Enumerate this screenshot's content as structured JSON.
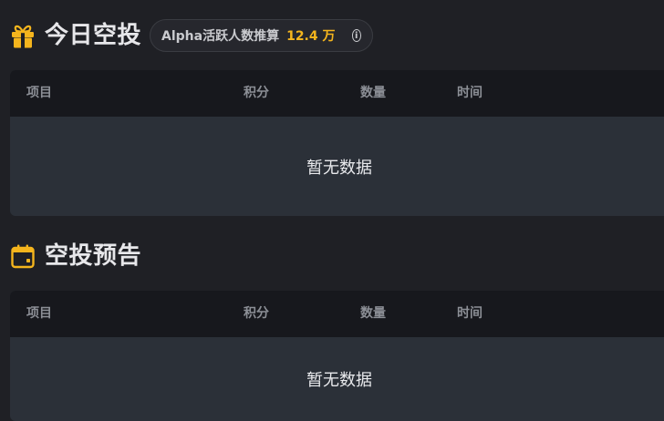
{
  "airdrop_today": {
    "title": "今日空投",
    "pill": {
      "label": "Alpha活跃人数推算",
      "value": "12.4 万",
      "info_symbol": "i"
    },
    "table": {
      "columns": [
        "项目",
        "积分",
        "数量",
        "时间"
      ],
      "empty_text": "暂无数据"
    }
  },
  "airdrop_forecast": {
    "title": "空投预告",
    "table": {
      "columns": [
        "项目",
        "积分",
        "数量",
        "时间"
      ],
      "empty_text": "暂无数据"
    }
  },
  "colors": {
    "background": "#1f2025",
    "table_header": "#17181d",
    "table_body": "#2b3038",
    "accent": "#f5b51d",
    "icon": "#f5b51d"
  },
  "icons": {
    "today_icon": "gift-icon",
    "forecast_icon": "calendar-icon",
    "pill_icon": "info-icon"
  }
}
